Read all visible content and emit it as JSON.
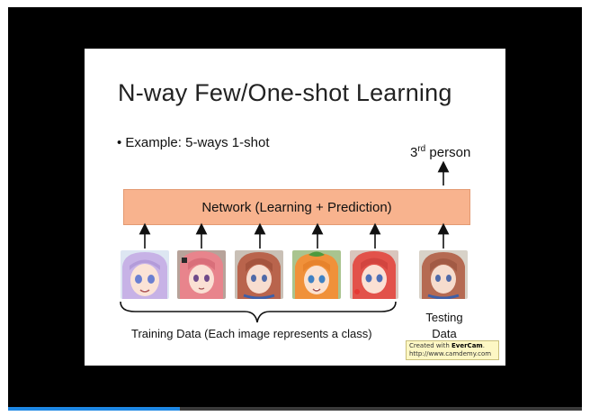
{
  "player": {
    "progress_fraction": 0.3,
    "accent_color": "#1e88e5"
  },
  "slide": {
    "title": "N-way Few/One-shot Learning",
    "bullet": "• Example: 5-ways 1-shot",
    "output_label": "person",
    "output_number": "3",
    "output_suffix": "rd",
    "network_label": "Network (Learning + Prediction)",
    "network_color": "#f8b38e",
    "training_label": "Training Data (Each image represents a class)",
    "testing_label_line1": "Testing",
    "testing_label_line2": "Data",
    "training_images": [
      {
        "name": "character-face-lavender-hair"
      },
      {
        "name": "character-face-pink-hair"
      },
      {
        "name": "character-face-auburn-hair"
      },
      {
        "name": "character-face-orange-hair"
      },
      {
        "name": "character-face-red-hair"
      }
    ],
    "testing_image": {
      "name": "character-face-auburn-hair-test"
    }
  },
  "watermark": {
    "prefix": "Created with ",
    "brand": "EverCam",
    "suffix": ".",
    "url": "http://www.camdemy.com"
  }
}
